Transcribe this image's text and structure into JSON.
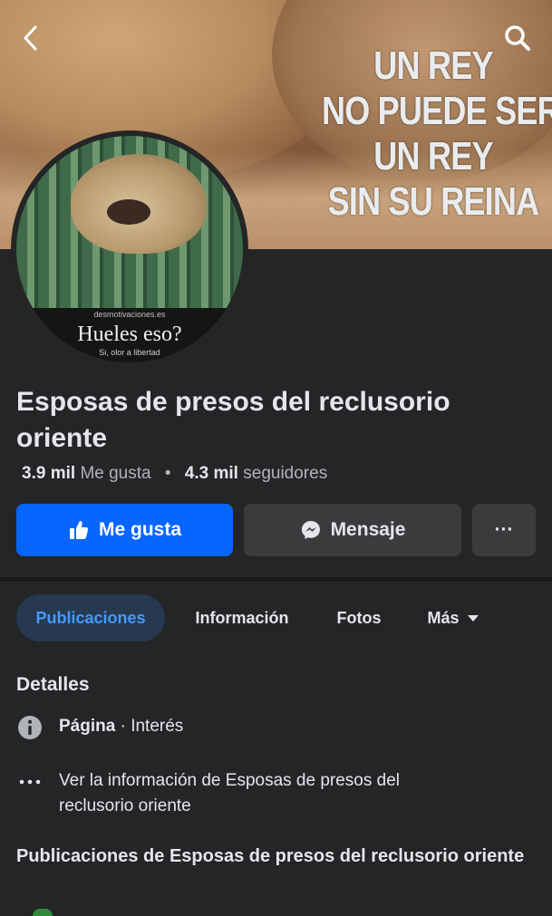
{
  "cover": {
    "text_lines": [
      "UN REY",
      "NO PUEDE SER",
      "UN REY",
      "SIN SU REINA"
    ]
  },
  "avatar": {
    "watermark": "desmotivaciones.es",
    "caption": "Hueles eso?",
    "subcaption": "Si, olor a libertad"
  },
  "page": {
    "title": "Esposas de presos del reclusorio oriente",
    "likes_count": "3.9 mil",
    "likes_label": "Me gusta",
    "followers_count": "4.3 mil",
    "followers_label": "seguidores"
  },
  "actions": {
    "like_label": "Me gusta",
    "message_label": "Mensaje",
    "more_label": "···"
  },
  "tabs": [
    {
      "label": "Publicaciones",
      "active": true
    },
    {
      "label": "Información",
      "active": false
    },
    {
      "label": "Fotos",
      "active": false
    },
    {
      "label": "Más",
      "active": false
    }
  ],
  "details": {
    "title": "Detalles",
    "category_bold": "Página",
    "category_rest": " · Interés",
    "see_info": "Ver la información de Esposas de presos del reclusorio oriente"
  },
  "posts": {
    "title": "Publicaciones de Esposas de presos del reclusorio oriente"
  },
  "colors": {
    "background": "#242526",
    "primary_button": "#0866ff",
    "secondary_button": "#3a3b3c",
    "active_tab_bg": "#263951",
    "active_tab_text": "#4599ff"
  },
  "icons": {
    "back": "chevron-left-icon",
    "search": "search-icon",
    "like": "thumbs-up-icon",
    "message": "messenger-icon",
    "more": "ellipsis-icon",
    "dropdown": "caret-down-icon",
    "info": "info-icon",
    "dots": "ellipsis-icon"
  }
}
